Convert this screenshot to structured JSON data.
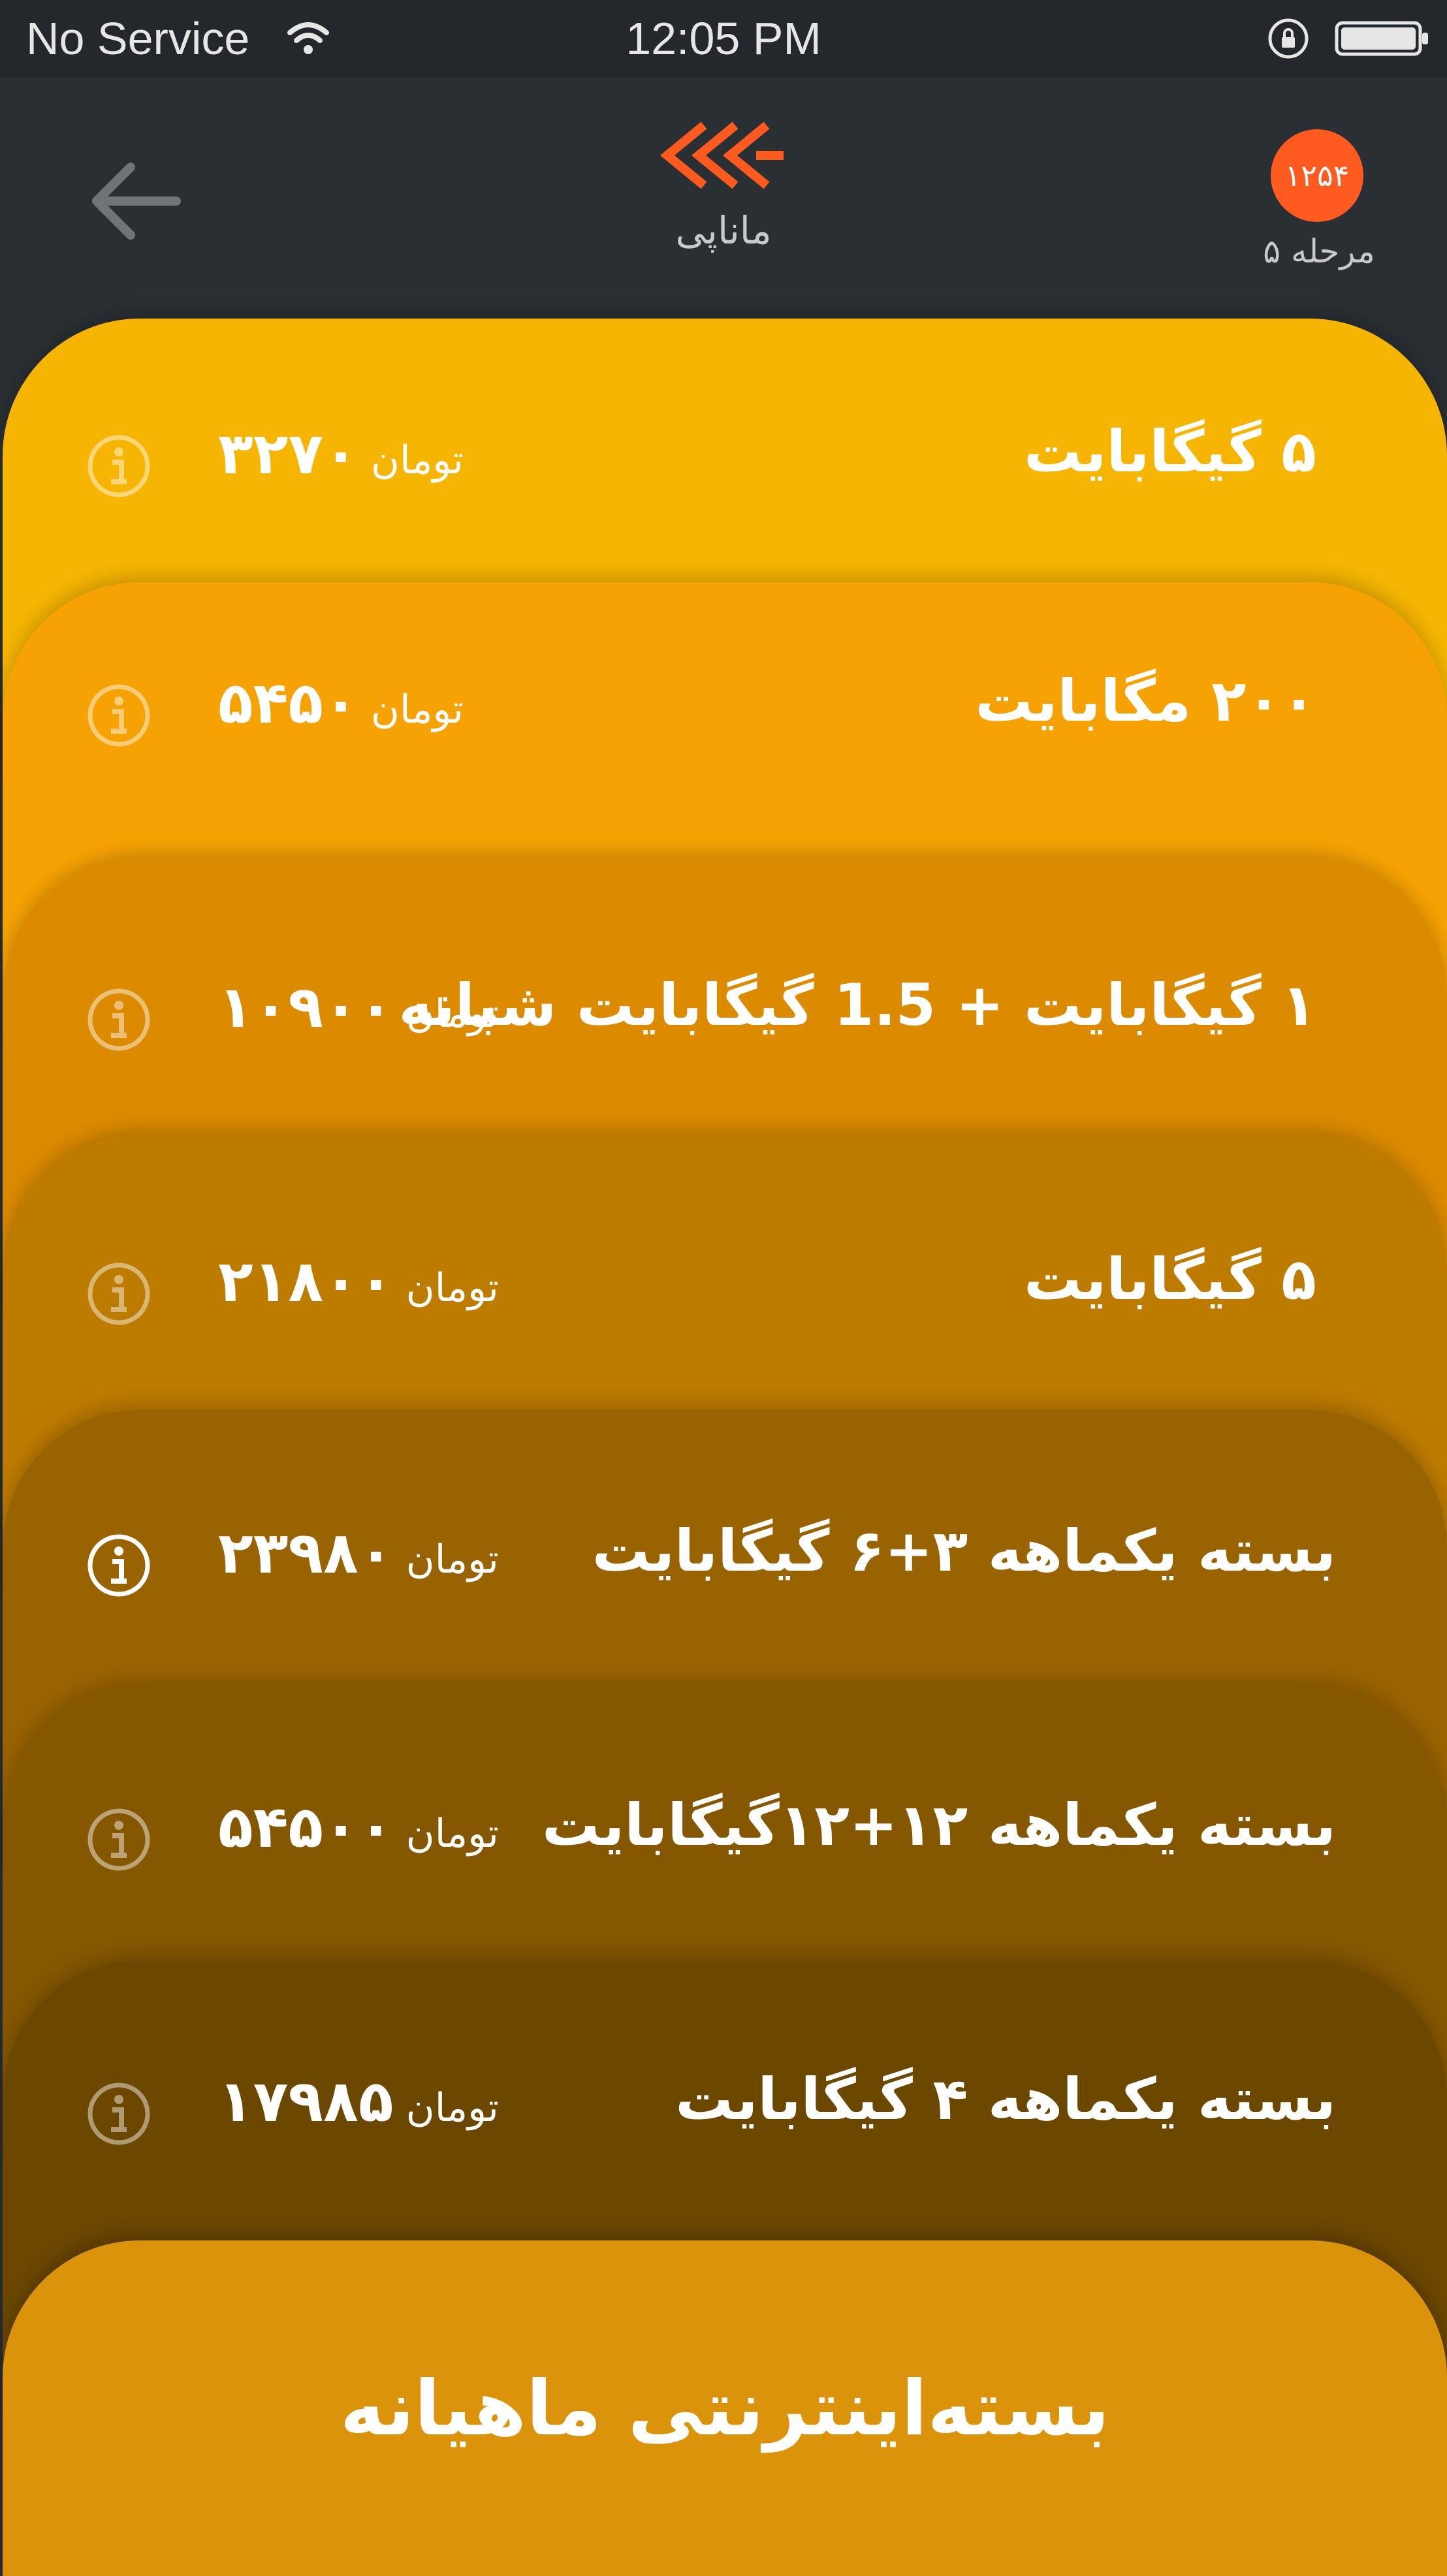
{
  "status_bar": {
    "carrier": "No Service",
    "time": "12:05 PM"
  },
  "header": {
    "app_name": "مانا‌پی",
    "level_count": "۱۲۵۴",
    "level_label": "مرحله ۵",
    "logo_color": "#ff5a1f"
  },
  "packages": [
    {
      "title": "۵ گیگابایت",
      "price": "۳۲۷۰",
      "unit": "تومان",
      "color": "#f6b503"
    },
    {
      "title": "۲۰۰ مگابایت",
      "price": "۵۴۵۰",
      "unit": "تومان",
      "color": "#f7a204"
    },
    {
      "title": "۱ گیگابایت + 1.5 گیگابایت شبانه",
      "price": "۱۰۹۰۰",
      "unit": "تومان",
      "color": "#dc8b01"
    },
    {
      "title": "۵ گیگابایت",
      "price": "۲۱۸۰۰",
      "unit": "تومان",
      "color": "#bd7b00"
    },
    {
      "title": "بسته یکماهه ۳+۶ گیگابایت",
      "price": "۲۳۹۸۰",
      "unit": "تومان",
      "color": "#9a6301"
    },
    {
      "title": "بسته یکماهه ۱۲+۱۲گیگابایت",
      "price": "۵۴۵۰۰",
      "unit": "تومان",
      "color": "#855700"
    },
    {
      "title": "بسته یکماهه ۴ گیگابایت",
      "price": "۱۷۹۸۵",
      "unit": "تومان",
      "color": "#6b4700"
    }
  ],
  "footer": {
    "title": "بسته‌اینترنتی ماهیانه",
    "color": "#db930b"
  }
}
